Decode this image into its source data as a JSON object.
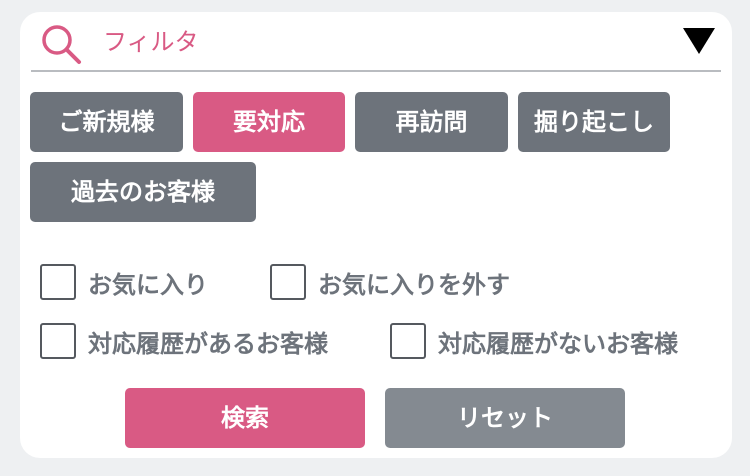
{
  "filter": {
    "placeholder": "フィルタ",
    "icon": "search-icon",
    "dropdown_icon": "dropdown-triangle-icon"
  },
  "tags": [
    {
      "label": "ご新規様",
      "selected": false
    },
    {
      "label": "要対応",
      "selected": true
    },
    {
      "label": "再訪問",
      "selected": false
    },
    {
      "label": "掘り起こし",
      "selected": false
    },
    {
      "label": "過去のお客様",
      "selected": false
    }
  ],
  "checkboxes": [
    {
      "label": "お気に入り",
      "checked": false
    },
    {
      "label": "お気に入りを外す",
      "checked": false
    },
    {
      "label": "対応履歴があるお客様",
      "checked": false
    },
    {
      "label": "対応履歴がないお客様",
      "checked": false
    }
  ],
  "actions": {
    "search_label": "検索",
    "reset_label": "リセット"
  },
  "colors": {
    "accent": "#d95a84",
    "tag_default": "#6d737b",
    "reset_button": "#848a91",
    "label_text": "#6d737b",
    "panel_background": "#ffffff"
  }
}
